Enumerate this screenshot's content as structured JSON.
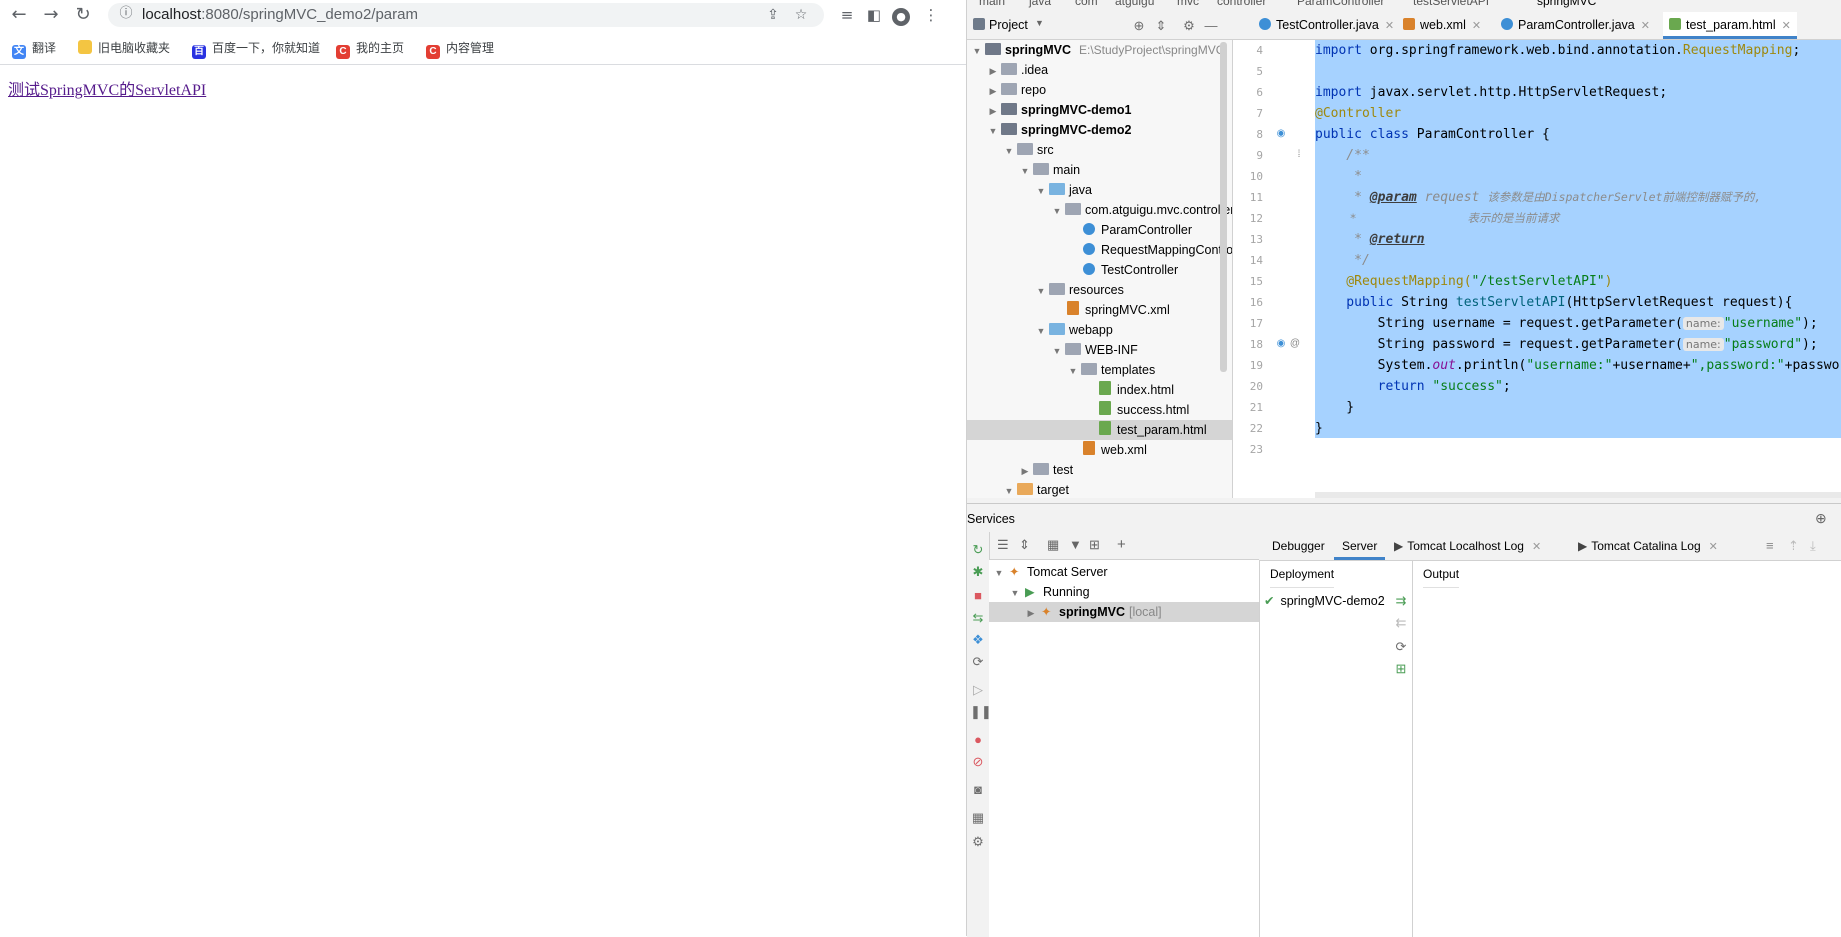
{
  "browser": {
    "url_host": "localhost",
    "url_rest": ":8080/springMVC_demo2/param",
    "bookmarks": [
      {
        "label": "翻译",
        "icon": "translate-icon",
        "color": "#4285f4"
      },
      {
        "label": "旧电脑收藏夹",
        "icon": "folder-icon",
        "color": "#f4c542"
      },
      {
        "label": "百度一下，你就知道",
        "icon": "baidu-icon",
        "color": "#2932e1"
      },
      {
        "label": "我的主页",
        "icon": "csdn-icon",
        "color": "#e33e33"
      },
      {
        "label": "内容管理",
        "icon": "csdn-icon",
        "color": "#e33e33"
      }
    ],
    "page_link": "测试SpringMVC的ServletAPI"
  },
  "ide": {
    "breadcrumbs": [
      "main",
      "java",
      "com",
      "atguigu",
      "mvc",
      "controller",
      "ParamController",
      "testServletAPI"
    ],
    "run_config": "springMVC",
    "project_label": "Project",
    "editor_tabs": [
      {
        "label": "TestController.java",
        "color": "#3d8fd6"
      },
      {
        "label": "web.xml",
        "color": "#d9822b"
      },
      {
        "label": "ParamController.java",
        "color": "#3d8fd6"
      },
      {
        "label": "test_param.html",
        "color": "#6aa84f"
      }
    ],
    "tree": [
      {
        "label": "springMVC",
        "sub": "E:\\StudyProject\\springMVC",
        "bold": true
      },
      {
        "label": ".idea"
      },
      {
        "label": "repo"
      },
      {
        "label": "springMVC-demo1",
        "bold": true
      },
      {
        "label": "springMVC-demo2",
        "bold": true
      },
      {
        "label": "src"
      },
      {
        "label": "main"
      },
      {
        "label": "java"
      },
      {
        "label": "com.atguigu.mvc.controller"
      },
      {
        "label": "ParamController"
      },
      {
        "label": "RequestMappingController"
      },
      {
        "label": "TestController"
      },
      {
        "label": "resources"
      },
      {
        "label": "springMVC.xml"
      },
      {
        "label": "webapp"
      },
      {
        "label": "WEB-INF"
      },
      {
        "label": "templates"
      },
      {
        "label": "index.html"
      },
      {
        "label": "success.html"
      },
      {
        "label": "test_param.html"
      },
      {
        "label": "web.xml"
      },
      {
        "label": "test"
      },
      {
        "label": "target"
      }
    ],
    "line_numbers": [
      "4",
      "5",
      "6",
      "7",
      "8",
      "9",
      "10",
      "11",
      "12",
      "13",
      "14",
      "15",
      "16",
      "17",
      "18",
      "19",
      "20",
      "21",
      "22",
      "23"
    ],
    "code": {
      "l4_kw": "import",
      "l4_rest": " org.springframework.web.bind.annotation.",
      "l4_ann": "RequestMapping",
      "l4_end": ";",
      "l6_kw": "import",
      "l6_rest": " javax.servlet.http.HttpServletRequest;",
      "l7_ann": "@Controller",
      "l8_kw": "public class",
      "l8_rest": " ParamController {",
      "l9": "    /**",
      "l10": "     *",
      "l11_pre": "     * ",
      "l11_tag": "@param",
      "l11_name": " request ",
      "l11_desc": "该参数是由DispatcherServlet前端控制器赋予的,",
      "l12": "     *                表示的是当前请求",
      "l13_pre": "     * ",
      "l13_tag": "@return",
      "l14": "     */",
      "l15_ann": "    @RequestMapping(",
      "l15_str": "\"/testServletAPI\"",
      "l15_end": ")",
      "l16_kw": "    public",
      "l16_rest": " String ",
      "l16_fn": "testServletAPI",
      "l16_end": "(HttpServletRequest request){",
      "l17_pre": "        String username = request.getParameter(",
      "l17_hint": "name:",
      "l17_str": "\"username\"",
      "l17_end": ");",
      "l18_pre": "        String password = request.getParameter(",
      "l18_hint": "name:",
      "l18_str": "\"password\"",
      "l18_end": ");",
      "l19_pre": "        System.",
      "l19_fld": "out",
      "l19_mid": ".println(",
      "l19_str1": "\"username:\"",
      "l19_mid2": "+username+",
      "l19_str2": "\",password:\"",
      "l19_end": "+password);",
      "l20_kw": "        return",
      "l20_str": " \"success\"",
      "l20_end": ";",
      "l21": "    }",
      "l22": "}"
    },
    "services": {
      "title": "Services",
      "tabs": [
        "Debugger",
        "Server",
        "Tomcat Localhost Log",
        "Tomcat Catalina Log"
      ],
      "tree": [
        {
          "label": "Tomcat Server"
        },
        {
          "label": "Running"
        },
        {
          "label": "springMVC",
          "sub": "[local]"
        }
      ],
      "deployment_header": "Deployment",
      "output_header": "Output",
      "deployment_item": "springMVC-demo2"
    }
  }
}
